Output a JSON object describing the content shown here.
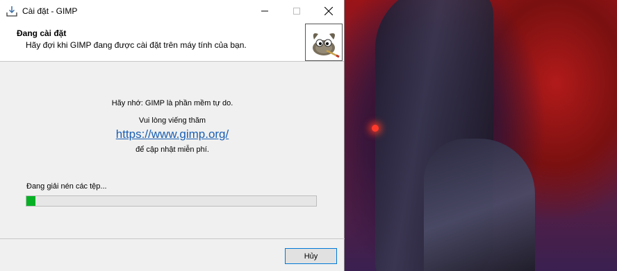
{
  "window": {
    "title": "Cài đặt - GIMP",
    "icon": "installer-download-icon"
  },
  "header": {
    "title": "Đang cài đặt",
    "subtitle": "Hãy đợi khi GIMP đang được cài đặt trên máy tính của bạn.",
    "logo": "gimp-wilber-logo"
  },
  "content": {
    "reminder": "Hãy nhớ: GIMP là phần mềm tự do.",
    "visit": "Vui lòng viếng thăm",
    "url": "https://www.gimp.org/",
    "update": "để cập nhật miễn phí."
  },
  "progress": {
    "status": "Đang giải nén các tệp...",
    "fraction": 0.03,
    "color": "#06b025"
  },
  "buttons": {
    "cancel": "Hủy"
  }
}
